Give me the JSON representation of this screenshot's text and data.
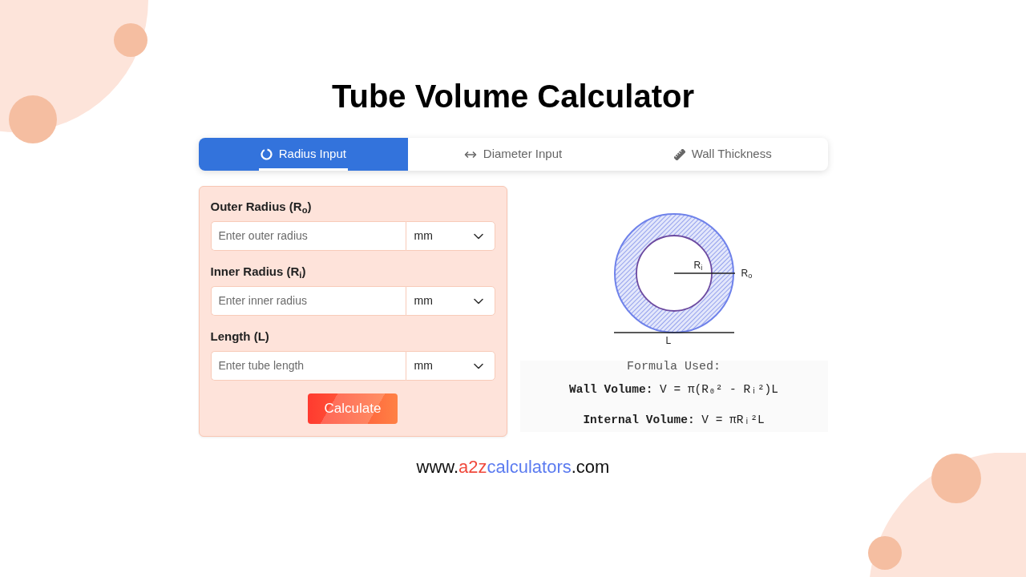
{
  "title": "Tube Volume Calculator",
  "tabs": [
    {
      "label": "Radius Input",
      "selected": true
    },
    {
      "label": "Diameter Input",
      "selected": false
    },
    {
      "label": "Wall Thickness",
      "selected": false
    }
  ],
  "fields": [
    {
      "label": "Outer Radius (R$_{o}$)",
      "placeholder": "Enter outer radius",
      "unit": "mm"
    },
    {
      "label": "Inner Radius (R$_{i}$)",
      "placeholder": "Enter inner radius",
      "unit": "mm"
    },
    {
      "label": "Length (L)",
      "placeholder": "Enter tube length",
      "unit": "mm"
    }
  ],
  "calculate_button": "Calculate",
  "diagram": {
    "inner_radius_label": "R$_{i}$",
    "outer_radius_label": "R$_{o}$",
    "length_label": "L"
  },
  "formula": {
    "heading": "Formula Used:",
    "lines": [
      "**Wall Volume:** V = π(R₀² - Rᵢ²)L",
      "**Internal Volume:** V = πRᵢ²L"
    ]
  },
  "website": {
    "prefix": "www.",
    "part_1": "a2z",
    "part_2": "calculators",
    "suffix": ".com"
  }
}
